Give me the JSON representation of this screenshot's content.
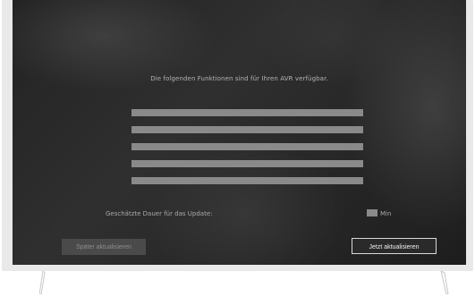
{
  "dialog": {
    "message": "Die folgenden Funktionen sind für Ihren AVR verfügbar.",
    "feature_count": 5,
    "duration_label": "Geschätzte Dauer für das Update:",
    "duration_unit": "Min",
    "later_button": "Später aktualisieren",
    "now_button": "Jetzt aktualisieren"
  },
  "colors": {
    "placeholder_bar": "#8a8a8a",
    "screen_bg": "#2e2e2e",
    "frame": "#e9e9e9"
  }
}
